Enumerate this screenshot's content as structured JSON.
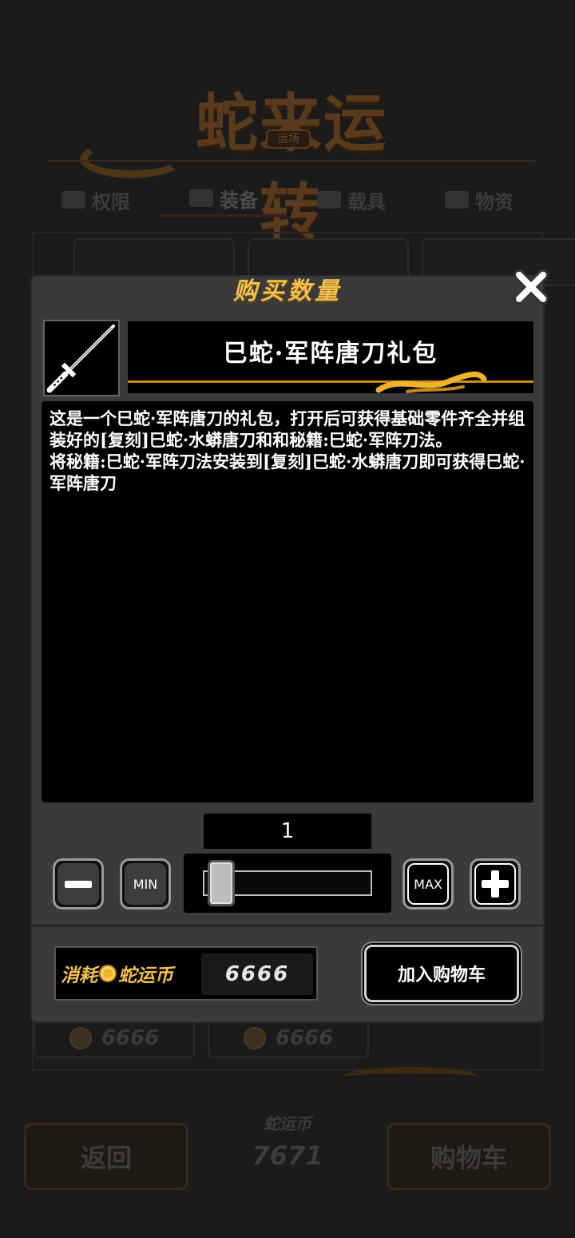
{
  "background": {
    "shop_title": "蛇来运转",
    "shop_subtitle": "运场",
    "tabs": [
      {
        "label": "权限",
        "icon": "crown-icon"
      },
      {
        "label": "装备",
        "icon": "shield-icon"
      },
      {
        "label": "载具",
        "icon": "vehicle-icon"
      },
      {
        "label": "物资",
        "icon": "crate-icon"
      }
    ],
    "card_prices": [
      "6666",
      "6666"
    ],
    "wallet_label": "蛇运币",
    "wallet_amount": "7671",
    "back_label": "返回",
    "cart_label": "购物车"
  },
  "modal": {
    "title": "购买数量",
    "item_name": "巳蛇·军阵唐刀礼包",
    "item_icon": "sword-icon",
    "description": "这是一个巳蛇·军阵唐刀的礼包，打开后可获得基础零件齐全并组装好的[复刻]巳蛇·水蟒唐刀和和秘籍:巳蛇·军阵刀法。\n将秘籍:巳蛇·军阵刀法安装到[复刻]巳蛇·水蟒唐刀即可获得巳蛇·军阵唐刀",
    "quantity": "1",
    "min_label": "MIN",
    "max_label": "MAX",
    "slider_fraction": 0,
    "cost_label_prefix": "消耗",
    "cost_label_currency": "蛇运币",
    "cost_value": "6666",
    "add_to_cart_label": "加入购物车"
  },
  "colors": {
    "accent_gold": "#f1c04c",
    "modal_bg": "#3a3a3a"
  }
}
